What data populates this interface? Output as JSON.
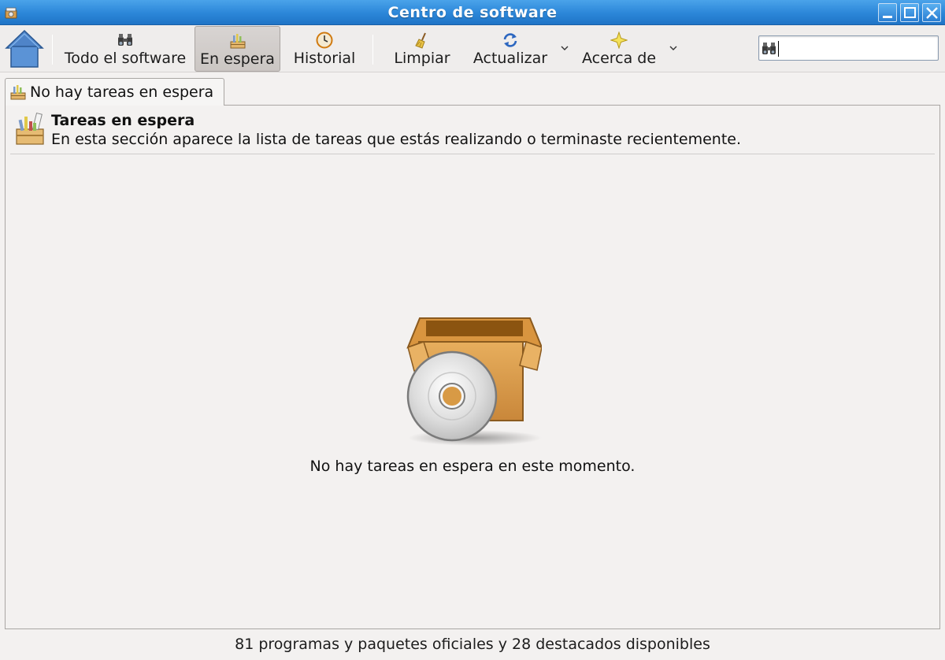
{
  "window": {
    "title": "Centro de software"
  },
  "toolbar": {
    "home_icon": "home-icon",
    "items": [
      {
        "label": "Todo el software",
        "icon": "binoculars-icon"
      },
      {
        "label": "En espera",
        "icon": "tasks-icon",
        "active": true
      },
      {
        "label": "Historial",
        "icon": "clock-icon"
      },
      {
        "label": "Limpiar",
        "icon": "broom-icon"
      },
      {
        "label": "Actualizar",
        "icon": "refresh-icon"
      },
      {
        "label": "Acerca de",
        "icon": "star-icon"
      }
    ],
    "search": {
      "value": "",
      "icon": "binoculars-icon"
    }
  },
  "tab": {
    "label": "No hay tareas en espera",
    "icon": "tasks-icon"
  },
  "section": {
    "title": "Tareas en espera",
    "description": "En esta sección aparece la lista de tareas que estás realizando o terminaste recientemente.",
    "icon": "tasks-icon"
  },
  "empty_state": {
    "icon": "package-disc-icon",
    "message": "No hay tareas en espera en este momento."
  },
  "statusbar": {
    "text": "81 programas y paquetes oficiales y 28 destacados disponibles"
  },
  "colors": {
    "titlebar": "#2b86d8",
    "background": "#f3f1f0",
    "box": "#d89a45"
  }
}
